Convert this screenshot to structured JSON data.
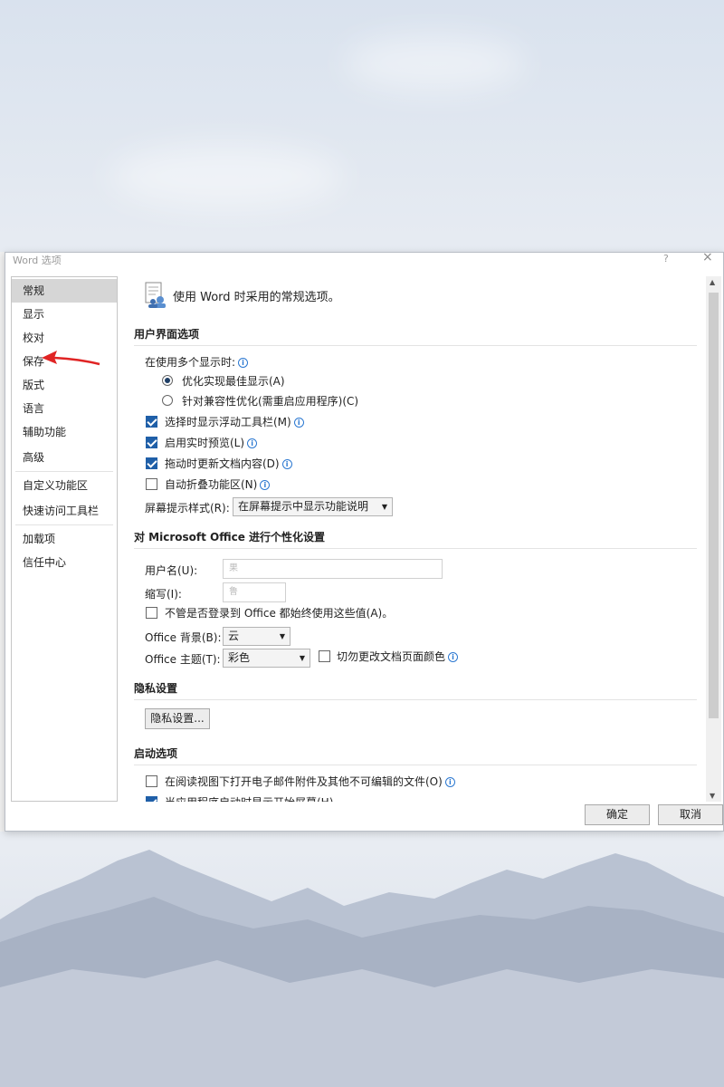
{
  "window": {
    "title": "Word 选项",
    "help": "?",
    "close": "×"
  },
  "nav": {
    "items": [
      {
        "label": "常规"
      },
      {
        "label": "显示"
      },
      {
        "label": "校对"
      },
      {
        "label": "保存"
      },
      {
        "label": "版式"
      },
      {
        "label": "语言"
      },
      {
        "label": "辅助功能"
      },
      {
        "label": "高级"
      },
      {
        "label": "自定义功能区"
      },
      {
        "label": "快速访问工具栏"
      },
      {
        "label": "加载项"
      },
      {
        "label": "信任中心"
      }
    ],
    "selected": "常规"
  },
  "header": {
    "text": "使用 Word 时采用的常规选项。"
  },
  "ui_options": {
    "title": "用户界面选项",
    "multi_display_label": "在使用多个显示时:",
    "radio_best": "优化实现最佳显示(A)",
    "radio_compat": "针对兼容性优化(需重启应用程序)(C)",
    "cb_mini_toolbar": "选择时显示浮动工具栏(M)",
    "cb_live_preview": "启用实时预览(L)",
    "cb_update_drag": "拖动时更新文档内容(D)",
    "cb_collapse_ribbon": "自动折叠功能区(N)",
    "screentip_label": "屏幕提示样式(R):",
    "screentip_value": "在屏幕提示中显示功能说明"
  },
  "personalize": {
    "title": "对 Microsoft Office 进行个性化设置",
    "username_label": "用户名(U):",
    "username_value": "果",
    "initials_label": "缩写(I):",
    "initials_value": "鲁",
    "cb_always_use": "不管是否登录到 Office 都始终使用这些值(A)。",
    "background_label": "Office 背景(B):",
    "background_value": "云",
    "theme_label": "Office 主题(T):",
    "theme_value": "彩色",
    "cb_never_change": "切勿更改文档页面颜色"
  },
  "privacy": {
    "title": "隐私设置",
    "button": "隐私设置..."
  },
  "startup": {
    "title": "启动选项",
    "cb_open_reading": "在阅读视图下打开电子邮件附件及其他不可编辑的文件(O)",
    "cb_show_start": "当应用程序启动时显示开始屏幕(H)"
  },
  "footer": {
    "ok": "确定",
    "cancel": "取消"
  },
  "icons": {
    "info": "info-icon",
    "arrow": "red-arrow-annotation"
  },
  "colors": {
    "selected_nav": "#d6d6d6",
    "checkbox": "#1f5fa8",
    "arrow": "#e02424"
  }
}
